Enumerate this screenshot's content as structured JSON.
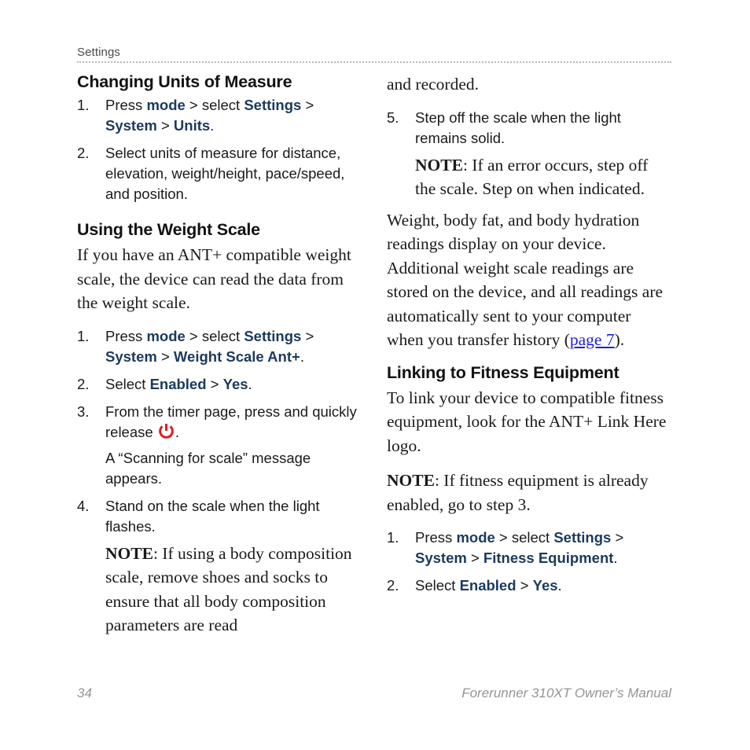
{
  "header": {
    "title": "Settings"
  },
  "left_column": {
    "section1": {
      "heading": "Changing Units of Measure",
      "steps": [
        {
          "num": "1.",
          "parts": [
            {
              "t": "Press ",
              "style": "plain"
            },
            {
              "t": "mode",
              "style": "ui"
            },
            {
              "t": " > select ",
              "style": "plain"
            },
            {
              "t": "Settings",
              "style": "ui"
            },
            {
              "t": " > ",
              "style": "plain"
            },
            {
              "t": "System",
              "style": "ui"
            },
            {
              "t": " > ",
              "style": "plain"
            },
            {
              "t": "Units",
              "style": "ui"
            },
            {
              "t": ".",
              "style": "plain"
            }
          ]
        },
        {
          "num": "2.",
          "parts": [
            {
              "t": "Select units of measure for distance, elevation, weight/height, pace/speed, and position.",
              "style": "plain"
            }
          ]
        }
      ]
    },
    "section2": {
      "heading": "Using the Weight Scale",
      "intro": "If you have an ANT+ compatible weight scale, the device can read the data from the weight scale.",
      "steps": [
        {
          "num": "1.",
          "parts": [
            {
              "t": "Press ",
              "style": "plain"
            },
            {
              "t": "mode",
              "style": "ui"
            },
            {
              "t": " > select ",
              "style": "plain"
            },
            {
              "t": "Settings",
              "style": "ui"
            },
            {
              "t": " > ",
              "style": "plain"
            },
            {
              "t": "System",
              "style": "ui"
            },
            {
              "t": " > ",
              "style": "plain"
            },
            {
              "t": "Weight Scale Ant+",
              "style": "ui"
            },
            {
              "t": ".",
              "style": "plain"
            }
          ]
        },
        {
          "num": "2.",
          "parts": [
            {
              "t": "Select ",
              "style": "plain"
            },
            {
              "t": "Enabled",
              "style": "ui"
            },
            {
              "t": " > ",
              "style": "plain"
            },
            {
              "t": "Yes",
              "style": "ui"
            },
            {
              "t": ".",
              "style": "plain"
            }
          ]
        },
        {
          "num": "3.",
          "parts": [
            {
              "t": "From the timer page, press and quickly release ",
              "style": "plain"
            },
            {
              "t": "",
              "style": "power-icon"
            },
            {
              "t": ".",
              "style": "plain"
            }
          ],
          "follow_sans": "A “Scanning for scale” message appears."
        },
        {
          "num": "4.",
          "parts": [
            {
              "t": "Stand on the scale when the light flashes.",
              "style": "plain"
            }
          ],
          "follow_serif_bold": "NOTE",
          "follow_serif": ": If using a body composition scale, remove shoes and socks to ensure that all body composition parameters are read"
        }
      ]
    }
  },
  "right_column": {
    "continuation": "and recorded.",
    "steps": [
      {
        "num": "5.",
        "parts": [
          {
            "t": "Step off the scale when the light remains solid.",
            "style": "plain"
          }
        ],
        "follow_serif_bold": "NOTE",
        "follow_serif": ": If an error occurs, step off the scale. Step on when indicated."
      }
    ],
    "paragraph1_a": "Weight, body fat, and body hydration readings display on your device. Additional weight scale readings are stored on the device, and all readings are automatically sent to your computer when you transfer history (",
    "paragraph1_link": "page 7",
    "paragraph1_b": ").",
    "section3": {
      "heading": "Linking to Fitness Equipment",
      "intro": "To link your device to compatible fitness equipment, look for the ANT+ Link Here logo.",
      "note_bold": "NOTE",
      "note_rest": ": If fitness equipment is already enabled, go to step 3.",
      "steps": [
        {
          "num": "1.",
          "parts": [
            {
              "t": "Press ",
              "style": "plain"
            },
            {
              "t": "mode",
              "style": "ui"
            },
            {
              "t": " > select ",
              "style": "plain"
            },
            {
              "t": "Settings",
              "style": "ui"
            },
            {
              "t": " > ",
              "style": "plain"
            },
            {
              "t": "System",
              "style": "ui"
            },
            {
              "t": " > ",
              "style": "plain"
            },
            {
              "t": "Fitness Equipment",
              "style": "ui"
            },
            {
              "t": ".",
              "style": "plain"
            }
          ]
        },
        {
          "num": "2.",
          "parts": [
            {
              "t": "Select ",
              "style": "plain"
            },
            {
              "t": "Enabled",
              "style": "ui"
            },
            {
              "t": " > ",
              "style": "plain"
            },
            {
              "t": "Yes",
              "style": "ui"
            },
            {
              "t": ".",
              "style": "plain"
            }
          ]
        }
      ]
    }
  },
  "footer": {
    "page_number": "34",
    "manual_title": "Forerunner 310XT Owner’s Manual"
  },
  "colors": {
    "ui_term_blue": "#1b3a5c",
    "link_blue": "#2020d8",
    "power_icon_red": "#e01b22",
    "footer_gray": "#949494",
    "header_gray": "#4a4a4a"
  }
}
